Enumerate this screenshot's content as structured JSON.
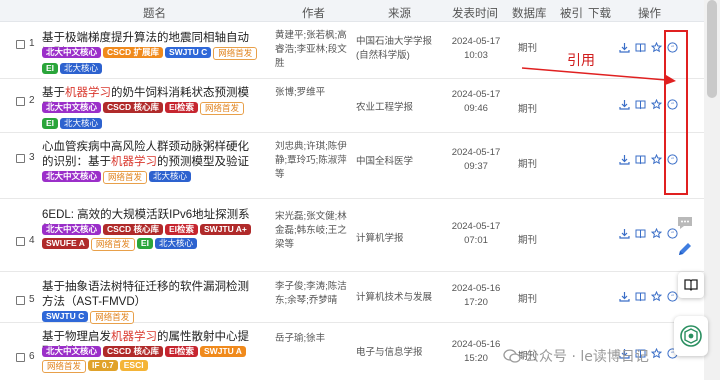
{
  "header": {
    "title": "题名",
    "author": "作者",
    "source": "来源",
    "date": "发表时间",
    "db": "数据库",
    "cited": "被引",
    "download": "下载",
    "ops": "操作"
  },
  "rows": [
    {
      "index": "1",
      "title_parts": [
        {
          "t": "基于极端梯度提升算法的地震同相轴自动识别",
          "h": false
        }
      ],
      "tags": [
        {
          "label": "北大中文核心",
          "cls": "t-pku"
        },
        {
          "label": "CSCD 扩展库",
          "cls": "t-csc"
        },
        {
          "label": "SWJTU C",
          "cls": "t-sw"
        },
        {
          "label": "网络首发",
          "cls": "t-net"
        },
        {
          "label": "EI",
          "cls": "t-ei"
        },
        {
          "label": "北大核心",
          "cls": "t-bd"
        }
      ],
      "authors": "黄建平;张若枫;高睿浩;李亚林;段文胜",
      "source": "中国石油大学学报(自然科学版)",
      "date": "2024-05-17",
      "time": "10:03",
      "db": "期刊"
    },
    {
      "index": "2",
      "title_parts": [
        {
          "t": "基于",
          "h": false
        },
        {
          "t": "机器学习",
          "h": true
        },
        {
          "t": "的奶牛饲料消耗状态预测模型",
          "h": false
        }
      ],
      "tags": [
        {
          "label": "北大中文核心",
          "cls": "t-pku"
        },
        {
          "label": "CSCD 核心库",
          "cls": "t-cscd"
        },
        {
          "label": "EI检索",
          "cls": "t-eiv"
        },
        {
          "label": "网络首发",
          "cls": "t-net"
        },
        {
          "label": "EI",
          "cls": "t-ei"
        },
        {
          "label": "北大核心",
          "cls": "t-bd"
        }
      ],
      "authors": "张博;罗维平",
      "source": "农业工程学报",
      "date": "2024-05-17",
      "time": "09:46",
      "db": "期刊"
    },
    {
      "index": "3",
      "title_parts": [
        {
          "t": "心血管疾病中高风险人群颈动脉粥样硬化的识别：基于",
          "h": false
        },
        {
          "t": "机器学习",
          "h": true
        },
        {
          "t": "的预测模型及验证",
          "h": false
        }
      ],
      "tags": [
        {
          "label": "北大中文核心",
          "cls": "t-pku"
        },
        {
          "label": "网络首发",
          "cls": "t-net"
        },
        {
          "label": "北大核心",
          "cls": "t-bd"
        }
      ],
      "authors": "刘忠典;许琪;陈伊静;覃玲巧;陈淑萍等",
      "source": "中国全科医学",
      "date": "2024-05-17",
      "time": "09:37",
      "db": "期刊"
    },
    {
      "index": "4",
      "title_parts": [
        {
          "t": "6EDL: 高效的大规模活跃IPv6地址探测系统",
          "h": false
        }
      ],
      "tags": [
        {
          "label": "北大中文核心",
          "cls": "t-pku"
        },
        {
          "label": "CSCD 核心库",
          "cls": "t-cscd"
        },
        {
          "label": "EI检索",
          "cls": "t-eiv"
        },
        {
          "label": "SWJTU A+",
          "cls": "t-cscd"
        },
        {
          "label": "SWUFE A",
          "cls": "t-cscd"
        },
        {
          "label": "网络首发",
          "cls": "t-net"
        },
        {
          "label": "EI",
          "cls": "t-ei"
        },
        {
          "label": "北大核心",
          "cls": "t-bd"
        }
      ],
      "authors": "宋光磊;张文健;林金磊;韩东岐;王之梁等",
      "source": "计算机学报",
      "date": "2024-05-17",
      "time": "07:01",
      "db": "期刊"
    },
    {
      "index": "5",
      "title_parts": [
        {
          "t": "基于抽象语法树特征迁移的软件漏洞检测方法（AST-FMVD）",
          "h": false
        }
      ],
      "tags": [
        {
          "label": "SWJTU C",
          "cls": "t-sw"
        },
        {
          "label": "网络首发",
          "cls": "t-net"
        }
      ],
      "authors": "李子俊;李涛;陈洁东;余琴;乔梦晴",
      "source": "计算机技术与发展",
      "date": "2024-05-16",
      "time": "17:20",
      "db": "期刊"
    },
    {
      "index": "6",
      "title_parts": [
        {
          "t": "基于物理启发",
          "h": false
        },
        {
          "t": "机器学习",
          "h": true
        },
        {
          "t": "的属性散射中心提取方法",
          "h": false
        }
      ],
      "tags": [
        {
          "label": "北大中文核心",
          "cls": "t-pku"
        },
        {
          "label": "CSCD 核心库",
          "cls": "t-cscd"
        },
        {
          "label": "EI检索",
          "cls": "t-eiv"
        },
        {
          "label": "SWJTU A",
          "cls": "t-csc"
        },
        {
          "label": "网络首发",
          "cls": "t-net"
        },
        {
          "label": "IF 0.7",
          "cls": "t-ifv"
        },
        {
          "label": "ESCI",
          "cls": "t-esci"
        }
      ],
      "authors": "岳子瑜;徐丰",
      "source": "电子与信息学报",
      "date": "2024-05-16",
      "time": "15:20",
      "db": "期刊"
    }
  ],
  "annotation": {
    "label": "引用",
    "color": "#e02020"
  },
  "icons": {
    "download": "download-icon",
    "read": "book-icon",
    "favorite": "star-icon",
    "cite": "quote-icon"
  },
  "sidebar": {
    "comment": "comment-icon",
    "edit": "pencil-icon",
    "book": "book-icon",
    "ai": "ai-assistant-icon"
  },
  "watermark": {
    "text": "公众号 · le读博日记"
  }
}
